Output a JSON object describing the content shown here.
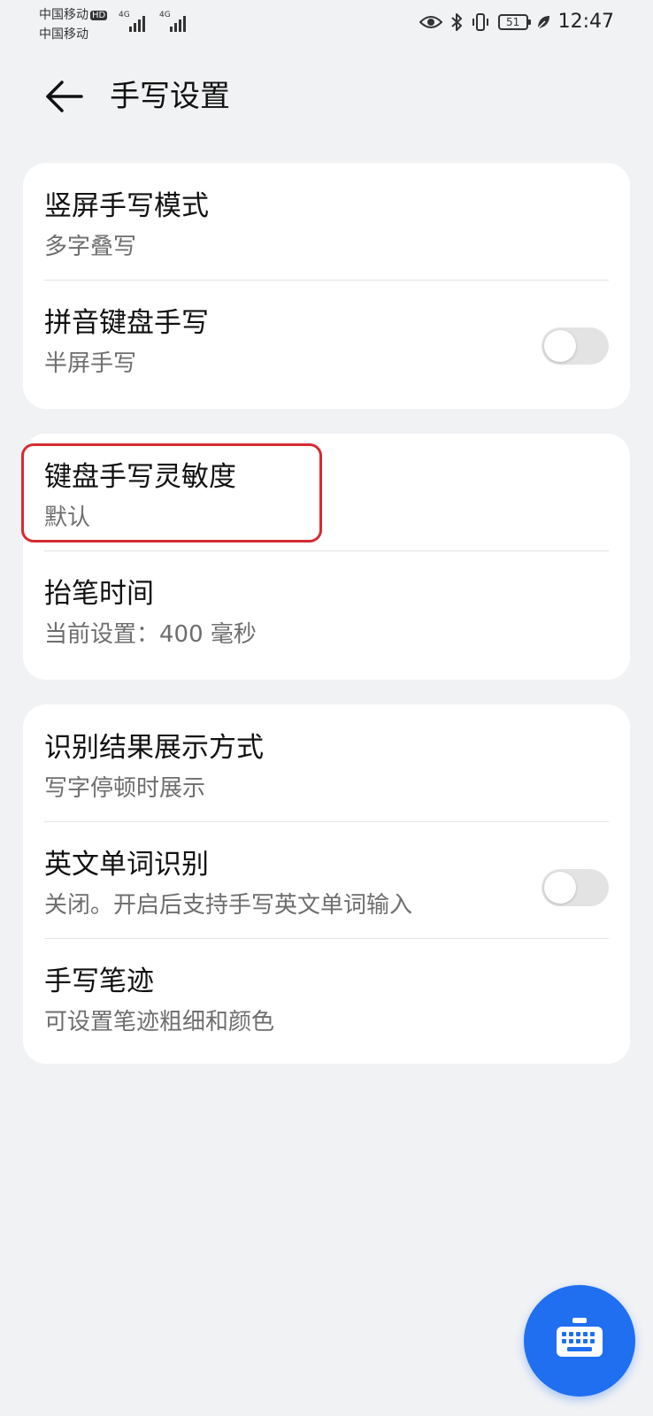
{
  "status_bar": {
    "carrier_1": "中国移动",
    "carrier_1_badge": "HD",
    "carrier_2": "中国移动",
    "signal_1_tag": "4G",
    "signal_2_tag": "4G",
    "battery_level": "51",
    "time": "12:47",
    "icons": [
      "eye-comfort-icon",
      "bluetooth-icon",
      "vibrate-icon",
      "battery-icon",
      "leaf-power-saving-icon"
    ]
  },
  "header": {
    "title": "手写设置",
    "back_icon": "back-arrow-icon"
  },
  "groups": [
    {
      "items": [
        {
          "title": "竖屏手写模式",
          "subtitle": "多字叠写"
        },
        {
          "title": "拼音键盘手写",
          "subtitle": "半屏手写",
          "toggle": false
        }
      ]
    },
    {
      "items": [
        {
          "title": "键盘手写灵敏度",
          "subtitle": "默认",
          "highlighted": true
        },
        {
          "title": "抬笔时间",
          "subtitle": "当前设置：400 毫秒"
        }
      ]
    },
    {
      "items": [
        {
          "title": "识别结果展示方式",
          "subtitle": "写字停顿时展示"
        },
        {
          "title": "英文单词识别",
          "subtitle": "关闭。开启后支持手写英文单词输入",
          "toggle": false
        },
        {
          "title": "手写笔迹",
          "subtitle": "可设置笔迹粗细和颜色"
        }
      ]
    }
  ],
  "fab": {
    "icon": "keyboard-icon"
  },
  "colors": {
    "background": "#f1f2f4",
    "card": "#ffffff",
    "accent": "#1f6ff0",
    "highlight": "#d62a33",
    "toggle_off": "#e3e3e3"
  }
}
